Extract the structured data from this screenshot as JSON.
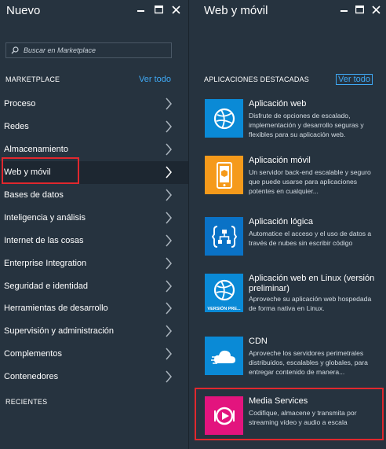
{
  "left_blade": {
    "title": "Nuevo",
    "search_placeholder": "Buscar en Marketplace",
    "marketplace_label": "MARKETPLACE",
    "see_all": "Ver todo",
    "categories": [
      {
        "label": "Proceso"
      },
      {
        "label": "Redes"
      },
      {
        "label": "Almacenamiento"
      },
      {
        "label": "Web y móvil",
        "selected": true
      },
      {
        "label": "Bases de datos"
      },
      {
        "label": "Inteligencia y análisis"
      },
      {
        "label": "Internet de las cosas"
      },
      {
        "label": "Enterprise Integration"
      },
      {
        "label": "Seguridad e identidad"
      },
      {
        "label": "Herramientas de desarrollo"
      },
      {
        "label": "Supervisión y administración"
      },
      {
        "label": "Complementos"
      },
      {
        "label": "Contenedores"
      }
    ],
    "recent_label": "RECIENTES"
  },
  "right_blade": {
    "title": "Web y móvil",
    "featured_label": "APLICACIONES DESTACADAS",
    "see_all": "Ver todo",
    "apps": [
      {
        "name": "Aplicación web",
        "description": "Disfrute de opciones de escalado, implementación y desarrollo seguras y flexibles para su aplicación web.",
        "icon": "globe-icon",
        "color": "#0a8ad6"
      },
      {
        "name": "Aplicación móvil",
        "description": "Un servidor back-end escalable y seguro que puede usarse para aplicaciones potentes en cualquier...",
        "icon": "mobile-app-icon",
        "color": "#f59a1b"
      },
      {
        "name": "Aplicación lógica",
        "description": "Automatice el acceso y el uso de datos a través de nubes sin escribir código",
        "icon": "logic-app-icon",
        "color": "#0a72c6"
      },
      {
        "name": "Aplicación web en Linux (versión preliminar)",
        "description": "Aproveche su aplicación web hospedada de forma nativa en Linux.",
        "icon": "globe-icon",
        "color": "#0a8ad6",
        "tile_caption": "VERSIÓN PRE..."
      },
      {
        "name": "CDN",
        "description": "Aproveche los servidores perimetrales distribuidos, escalables y globales, para entregar contenido de manera...",
        "icon": "cdn-cloud-icon",
        "color": "#0a8ad6"
      },
      {
        "name": "Media Services",
        "description": "Codifique, almacene y transmita por streaming vídeo y audio a escala",
        "icon": "media-play-icon",
        "color": "#e3147e"
      }
    ]
  },
  "colors": {
    "blade_bg": "#26333f",
    "link": "#3fa9f5",
    "highlight": "#e0282e"
  }
}
